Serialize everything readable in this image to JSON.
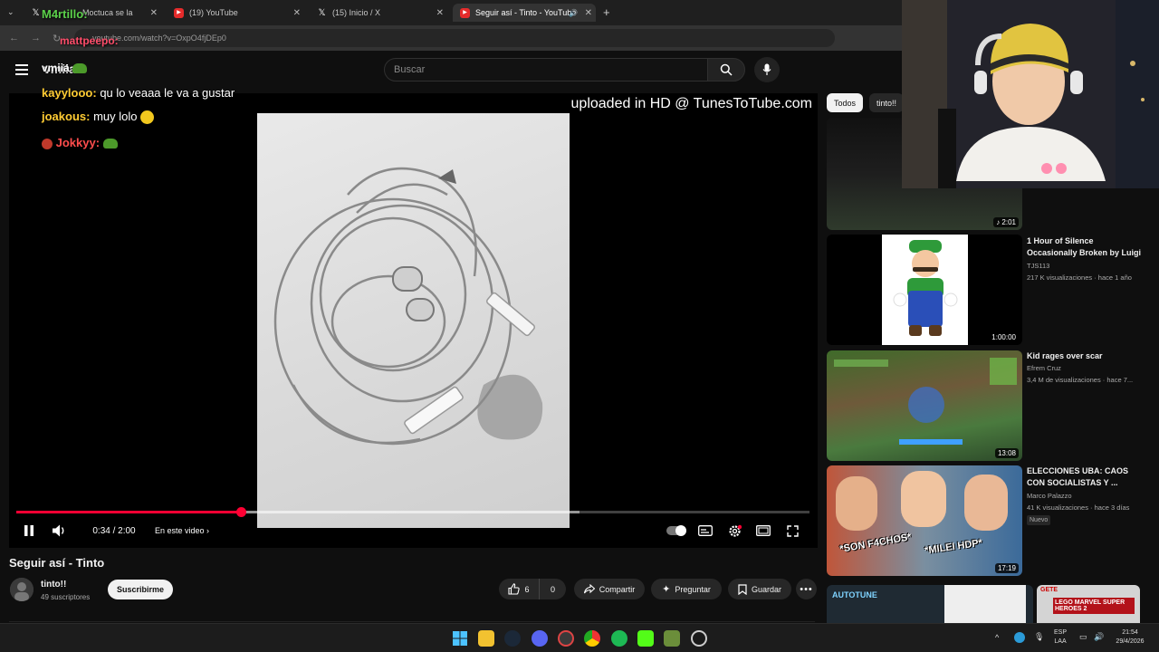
{
  "browser": {
    "tabs": [
      {
        "label": "Moctuca se la",
        "active": false
      },
      {
        "label": "(19) YouTube",
        "active": false
      },
      {
        "label": "(15) Inicio / X",
        "active": false
      },
      {
        "label": "Seguir así - Tinto - YouTube",
        "active": true
      }
    ],
    "url": "youtube.com/watch?v=OxpO4fjDEp0"
  },
  "youtube": {
    "logo": "vmiia",
    "search_placeholder": "Buscar"
  },
  "chat_overlay": [
    {
      "user": "M4rtillo:",
      "message": "",
      "color": "#5bd14a"
    },
    {
      "user": "mattpeepo:",
      "message": "",
      "color": "#ff4d6a"
    },
    {
      "user": "vmiia",
      "message": "",
      "color": "#ffffff"
    },
    {
      "user": "kayylooo:",
      "message": "qu lo veaaa le va a gustar",
      "color": "#ffcc33"
    },
    {
      "user": "joakous:",
      "message": "muy lolo",
      "color": "#ffcc33"
    },
    {
      "user": "Jokkyy:",
      "message": "",
      "color": "#ff4d4d"
    }
  ],
  "player": {
    "watermark": "uploaded in HD @ TunesToTube.com",
    "time": "0:34 / 2:00",
    "chapter_label": "En este video",
    "progress_fraction": 0.283,
    "buffer_fraction": 0.71
  },
  "video": {
    "title": "Seguir así - Tinto",
    "channel": "tinto!!",
    "subscribers": "49 suscriptores",
    "subscribe_label": "Suscribirme",
    "likes": "6",
    "dislikes": "0",
    "share_label": "Compartir",
    "ask_label": "Preguntar",
    "save_label": "Guardar"
  },
  "sidebar": {
    "chips": [
      "Todos",
      "tinto!!"
    ],
    "first_duration": "2:01",
    "recommendations": [
      {
        "title_line1": "1 Hour of Silence",
        "title_line2": "Occasionally Broken by Luigi",
        "channel": "TJS113",
        "meta": "217 K visualizaciones · hace 1 año",
        "duration": "1:00:00",
        "badge": ""
      },
      {
        "title_line1": "Kid rages over scar",
        "title_line2": "",
        "channel": "Efrem Cruz",
        "meta": "3,4 M de visualizaciones · hace 7...",
        "duration": "13:08",
        "badge": ""
      },
      {
        "title_line1": "ELECCIONES UBA: CAOS",
        "title_line2": "CON SOCIALISTAS Y ...",
        "channel": "Marco Palazzo",
        "meta": "41 K visualizaciones · hace 3 días",
        "duration": "17:19",
        "badge": "Nuevo"
      }
    ],
    "thumb_texts": {
      "uba_left": "*SON F4CHOS*",
      "uba_right": "*MILEI HDP*",
      "bottom_left": "AUTOTUNE",
      "bottom_right_top": "GETE",
      "bottom_right_brand": "LEGO MARVEL SUPER HEROES 2"
    }
  },
  "taskbar": {
    "lang_line1": "ESP",
    "lang_line2": "LAA",
    "time": "21:54",
    "date": "29/4/2026"
  },
  "colors": {
    "accent_red": "#ff0033",
    "background": "#0f0f0f"
  }
}
